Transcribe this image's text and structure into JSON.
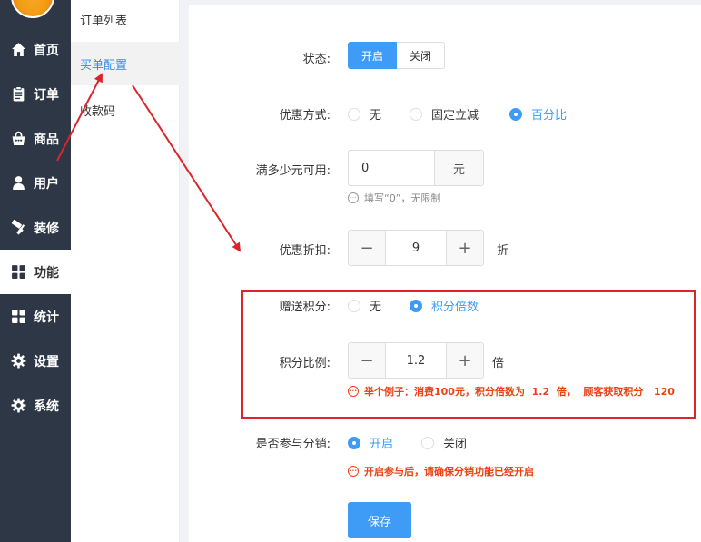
{
  "nav": {
    "items": [
      {
        "label": "首页",
        "icon": "home-icon"
      },
      {
        "label": "订单",
        "icon": "clipboard-icon"
      },
      {
        "label": "商品",
        "icon": "shopping-bag-icon"
      },
      {
        "label": "用户",
        "icon": "user-icon"
      },
      {
        "label": "装修",
        "icon": "paint-roller-icon"
      },
      {
        "label": "功能",
        "icon": "grid-icon"
      },
      {
        "label": "统计",
        "icon": "grid-icon"
      },
      {
        "label": "设置",
        "icon": "gear-icon"
      },
      {
        "label": "系统",
        "icon": "gear-icon"
      }
    ],
    "active": "功能"
  },
  "subnav": {
    "items": [
      "订单列表",
      "买单配置",
      "收款码"
    ],
    "active": "买单配置"
  },
  "form": {
    "status": {
      "label": "状态:",
      "on": "开启",
      "off": "关闭",
      "selected": "开启"
    },
    "discount_type": {
      "label": "优惠方式:",
      "options": [
        "无",
        "固定立减",
        "百分比"
      ],
      "selected": "百分比"
    },
    "min_amount": {
      "label": "满多少元可用:",
      "value": "0",
      "unit": "元",
      "hint": "填写“0”，无限制"
    },
    "discount_rate": {
      "label": "优惠折扣:",
      "value": "9",
      "unit": "折"
    },
    "bonus_points": {
      "label": "赠送积分:",
      "options": [
        "无",
        "积分倍数"
      ],
      "selected": "积分倍数"
    },
    "points_ratio": {
      "label": "积分比例:",
      "value": "1.2",
      "unit": "倍",
      "hint": "举个例子：消费100元，积分倍数为  1.2  倍，  顾客获取积分   120"
    },
    "distribution": {
      "label": "是否参与分销:",
      "options": [
        "开启",
        "关闭"
      ],
      "selected": "开启",
      "hint": "开启参与后，请确保分销功能已经开启"
    },
    "save_label": "保存"
  },
  "colors": {
    "accent": "#3e9cf6",
    "annotation": "#d9252b",
    "nav_bg": "#2e3746",
    "warning": "#ed4014"
  }
}
